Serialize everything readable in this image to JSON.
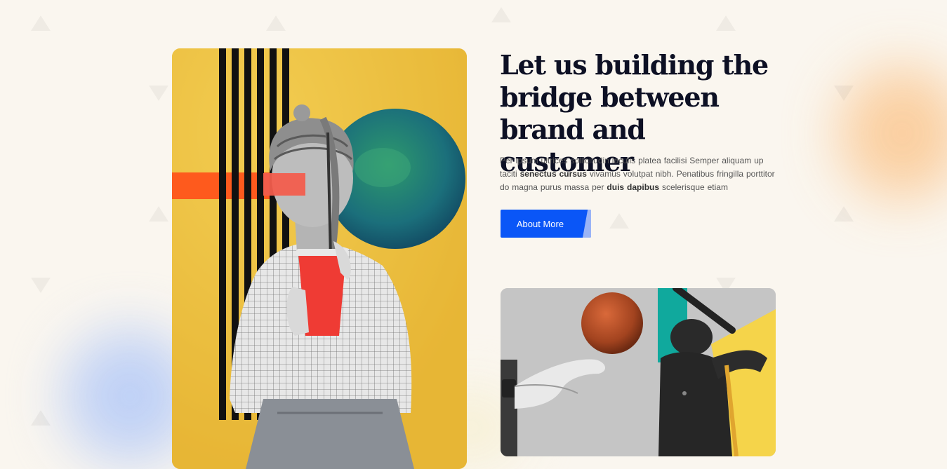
{
  "hero": {
    "title_line1": "Let us building the",
    "title_line2": "bridge between",
    "title_line3": "brand and customer",
    "description": {
      "part1": "Per ipsum ultrices sollicitudin iaculis platea facilisi Semper aliquam up taciti ",
      "bold1": "senectus cursus",
      "part2": " vivamus volutpat nibh. Penatibus fringilla porttitor do magna purus massa per ",
      "bold2": "duis dapibus",
      "part3": " scelerisque etiam"
    },
    "button_label": "About More"
  },
  "colors": {
    "accent": "#0a56f7",
    "headline": "#0d1024",
    "yellow_panel": "#f1c84a",
    "orange_stripe": "#fe5a1d",
    "background": "#faf6ef"
  },
  "images": {
    "main_collage": "collage-statue-with-drink-icon",
    "secondary_collage": "collage-baseball-player-icon"
  }
}
